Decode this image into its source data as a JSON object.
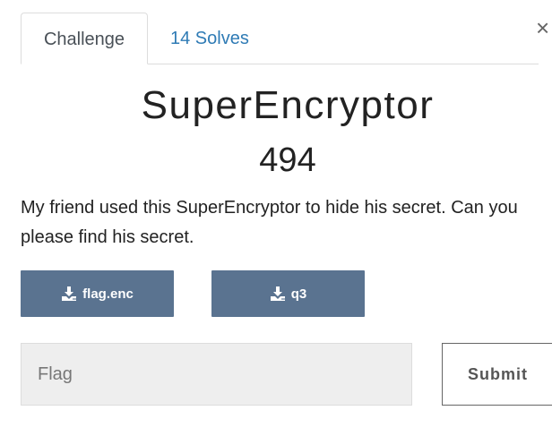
{
  "tabs": {
    "challenge_label": "Challenge",
    "solves_label": "14 Solves"
  },
  "close_glyph": "×",
  "challenge": {
    "name": "SuperEncryptor",
    "value": "494",
    "description": "My friend used this SuperEncryptor to hide his secret. Can you",
    "description_line2": "please find his secret."
  },
  "files": [
    {
      "label": "flag.enc",
      "icon": "download-icon"
    },
    {
      "label": "q3",
      "icon": "download-icon"
    }
  ],
  "form": {
    "flag_placeholder": "Flag",
    "submit_label": "Submit"
  },
  "colors": {
    "accent_link": "#2f7bb5",
    "file_button_bg": "#5a7390"
  }
}
